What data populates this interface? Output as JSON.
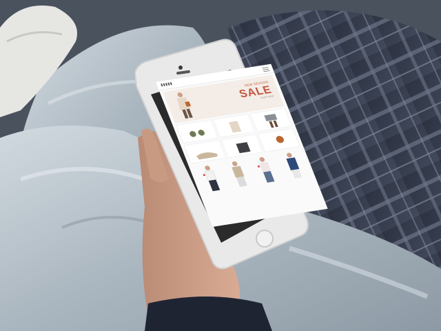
{
  "scene": {
    "description_free": true
  },
  "phone_screen": {
    "banner": {
      "kicker": "NEW SEASON",
      "title": "SALE",
      "cta": "SHOP NOW"
    }
  },
  "colors": {
    "sale_accent": "#c1543d",
    "jeans": "#b9c4cc",
    "plaid": "#3a4152",
    "phone_body": "#e9e9e9",
    "sleeve": "#1f2433"
  },
  "icons": [
    "home-button-icon",
    "camera-icon",
    "speaker-icon",
    "menu-icon"
  ]
}
